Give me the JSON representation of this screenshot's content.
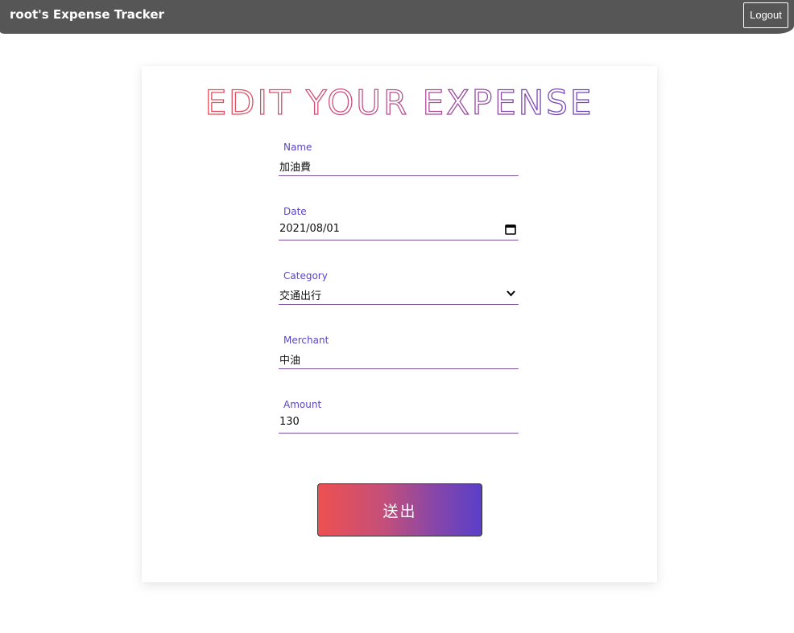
{
  "header": {
    "title": "root's Expense Tracker",
    "logout_label": "Logout"
  },
  "page": {
    "heading": "EDIT YOUR EXPENSE"
  },
  "form": {
    "name": {
      "label": "Name",
      "value": "加油費"
    },
    "date": {
      "label": "Date",
      "value": "2021/08/01"
    },
    "category": {
      "label": "Category",
      "value": "交通出行"
    },
    "merchant": {
      "label": "Merchant",
      "value": "中油"
    },
    "amount": {
      "label": "Amount",
      "value": "130"
    },
    "submit_label": "送出"
  },
  "colors": {
    "topbar": "#565656",
    "label": "#5b44c2",
    "gradient_start": "#ee5050",
    "gradient_end": "#5a3fc9"
  },
  "icons": {
    "date": "calendar-icon",
    "category": "chevron-down-icon"
  }
}
